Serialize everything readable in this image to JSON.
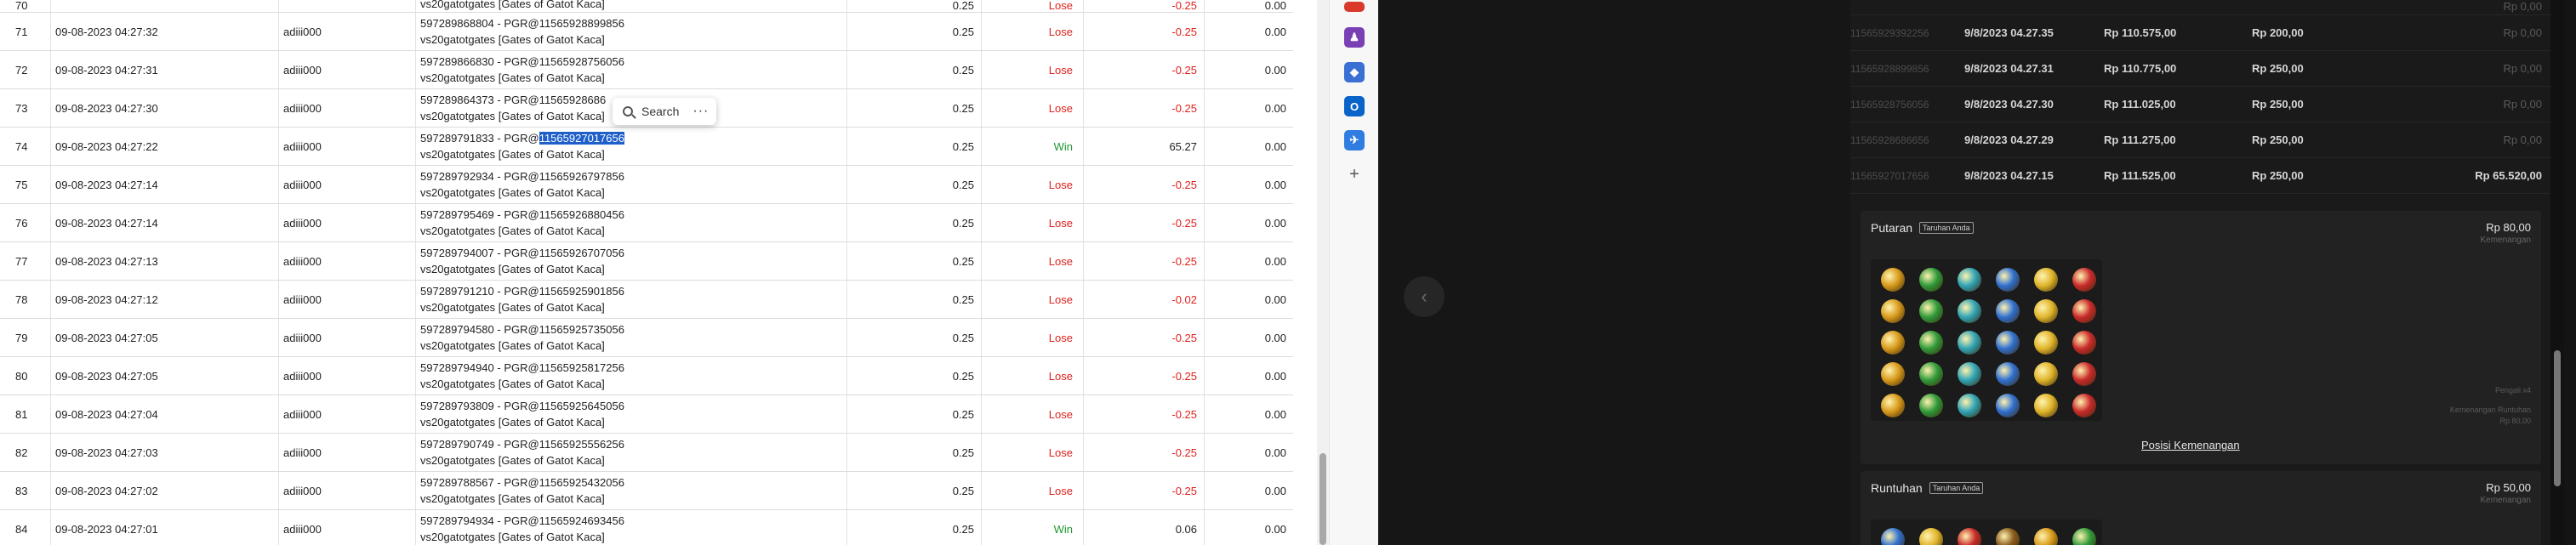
{
  "sheet": {
    "top_row": {
      "no": "70",
      "date": "",
      "user": "",
      "desc2": "vs20gatotgates [Gates of Gatot Kaca]",
      "bet": "0.25",
      "status": "Lose",
      "win": "-0.25",
      "jp": "0.00"
    },
    "rows": [
      {
        "no": "71",
        "date": "09-08-2023 04:27:32",
        "user": "adiii000",
        "desc1": "597289868804 - PGR@11565928899856",
        "desc2": "vs20gatotgates [Gates of Gatot Kaca]",
        "bet": "0.25",
        "status": "Lose",
        "win": "-0.25",
        "jp": "0.00"
      },
      {
        "no": "72",
        "date": "09-08-2023 04:27:31",
        "user": "adiii000",
        "desc1": "597289866830 - PGR@11565928756056",
        "desc2": "vs20gatotgates [Gates of Gatot Kaca]",
        "bet": "0.25",
        "status": "Lose",
        "win": "-0.25",
        "jp": "0.00"
      },
      {
        "no": "73",
        "date": "09-08-2023 04:27:30",
        "user": "adiii000",
        "desc1": "597289864373 - PGR@11565928686",
        "desc2": "vs20gatotgates [Gates of Gatot Kaca]",
        "bet": "0.25",
        "status": "Lose",
        "win": "-0.25",
        "jp": "0.00"
      },
      {
        "no": "74",
        "date": "09-08-2023 04:27:22",
        "user": "adiii000",
        "desc1_pre": "597289791833 - PGR@",
        "desc1_hl": "11565927017656",
        "desc2": "vs20gatotgates [Gates of Gatot Kaca]",
        "bet": "0.25",
        "status": "Win",
        "win": "65.27",
        "jp": "0.00"
      },
      {
        "no": "75",
        "date": "09-08-2023 04:27:14",
        "user": "adiii000",
        "desc1": "597289792934 - PGR@11565926797856",
        "desc2": "vs20gatotgates [Gates of Gatot Kaca]",
        "bet": "0.25",
        "status": "Lose",
        "win": "-0.25",
        "jp": "0.00"
      },
      {
        "no": "76",
        "date": "09-08-2023 04:27:14",
        "user": "adiii000",
        "desc1": "597289795469 - PGR@11565926880456",
        "desc2": "vs20gatotgates [Gates of Gatot Kaca]",
        "bet": "0.25",
        "status": "Lose",
        "win": "-0.25",
        "jp": "0.00"
      },
      {
        "no": "77",
        "date": "09-08-2023 04:27:13",
        "user": "adiii000",
        "desc1": "597289794007 - PGR@11565926707056",
        "desc2": "vs20gatotgates [Gates of Gatot Kaca]",
        "bet": "0.25",
        "status": "Lose",
        "win": "-0.25",
        "jp": "0.00"
      },
      {
        "no": "78",
        "date": "09-08-2023 04:27:12",
        "user": "adiii000",
        "desc1": "597289791210 - PGR@11565925901856",
        "desc2": "vs20gatotgates [Gates of Gatot Kaca]",
        "bet": "0.25",
        "status": "Lose",
        "win": "-0.02",
        "jp": "0.00"
      },
      {
        "no": "79",
        "date": "09-08-2023 04:27:05",
        "user": "adiii000",
        "desc1": "597289794580 - PGR@11565925735056",
        "desc2": "vs20gatotgates [Gates of Gatot Kaca]",
        "bet": "0.25",
        "status": "Lose",
        "win": "-0.25",
        "jp": "0.00"
      },
      {
        "no": "80",
        "date": "09-08-2023 04:27:05",
        "user": "adiii000",
        "desc1": "597289794940 - PGR@11565925817256",
        "desc2": "vs20gatotgates [Gates of Gatot Kaca]",
        "bet": "0.25",
        "status": "Lose",
        "win": "-0.25",
        "jp": "0.00"
      },
      {
        "no": "81",
        "date": "09-08-2023 04:27:04",
        "user": "adiii000",
        "desc1": "597289793809 - PGR@11565925645056",
        "desc2": "vs20gatotgates [Gates of Gatot Kaca]",
        "bet": "0.25",
        "status": "Lose",
        "win": "-0.25",
        "jp": "0.00"
      },
      {
        "no": "82",
        "date": "09-08-2023 04:27:03",
        "user": "adiii000",
        "desc1": "597289790749 - PGR@11565925556256",
        "desc2": "vs20gatotgates [Gates of Gatot Kaca]",
        "bet": "0.25",
        "status": "Lose",
        "win": "-0.25",
        "jp": "0.00"
      },
      {
        "no": "83",
        "date": "09-08-2023 04:27:02",
        "user": "adiii000",
        "desc1": "597289788567 - PGR@11565925432056",
        "desc2": "vs20gatotgates [Gates of Gatot Kaca]",
        "bet": "0.25",
        "status": "Lose",
        "win": "-0.25",
        "jp": "0.00"
      },
      {
        "no": "84",
        "date": "09-08-2023 04:27:01",
        "user": "adiii000",
        "desc1": "597289794934 - PGR@11565924693456",
        "desc2": "vs20gatotgates [Gates of Gatot Kaca]",
        "bet": "0.25",
        "status": "Win",
        "win": "0.06",
        "jp": "0.00"
      }
    ]
  },
  "context_menu": {
    "search_label": "Search",
    "more_label": "···"
  },
  "history": {
    "rows": [
      {
        "id": "",
        "date": "",
        "balance": "",
        "bet": "",
        "win": "Rp 0,00"
      },
      {
        "id": "11565929392256",
        "date": "9/8/2023 04.27.35",
        "balance": "Rp 110.575,00",
        "bet": "Rp 200,00",
        "win": "Rp 0,00"
      },
      {
        "id": "11565928899856",
        "date": "9/8/2023 04.27.31",
        "balance": "Rp 110.775,00",
        "bet": "Rp 250,00",
        "win": "Rp 0,00"
      },
      {
        "id": "11565928756056",
        "date": "9/8/2023 04.27.30",
        "balance": "Rp 111.025,00",
        "bet": "Rp 250,00",
        "win": "Rp 0,00"
      },
      {
        "id": "11565928686656",
        "date": "9/8/2023 04.27.29",
        "balance": "Rp 111.275,00",
        "bet": "Rp 250,00",
        "win": "Rp 0,00"
      },
      {
        "id": "11565927017656",
        "date": "9/8/2023 04.27.15",
        "balance": "Rp 111.525,00",
        "bet": "Rp 250,00",
        "win": "Rp 65.520,00"
      }
    ],
    "spin_card": {
      "title": "Putaran",
      "badge": "Taruhan Anda",
      "amount": "Rp 80,00",
      "amount_sub": "Kemenangan",
      "side1": "Pengali x4",
      "side2": "Kemenangan Runtuhan",
      "side3": "Rp 80,00",
      "link": "Posisi Kemenangan"
    },
    "cascade_card": {
      "title": "Runtuhan",
      "badge": "Taruhan Anda",
      "amount": "Rp 50,00",
      "amount_sub": "Kemenangan"
    }
  },
  "colors": {
    "lose": "#e0211d",
    "win": "#1f9a33",
    "highlight": "#1e5fc9",
    "app_bg": "#141414"
  }
}
